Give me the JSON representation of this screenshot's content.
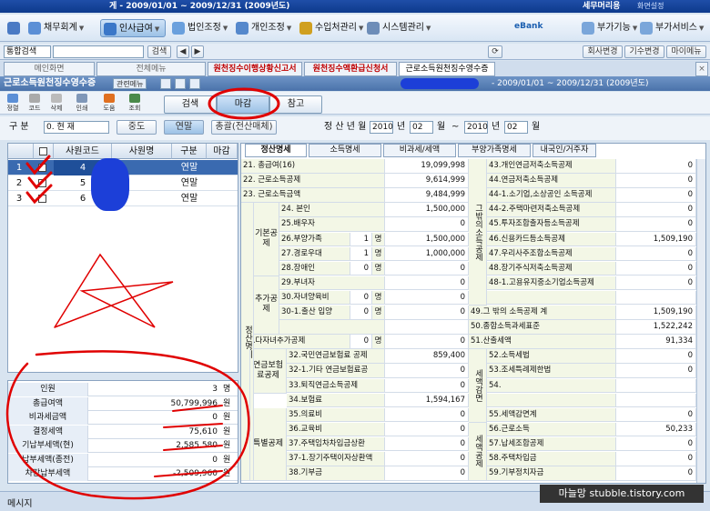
{
  "window": {
    "title": "게 - 2009/01/01 ~ 2009/12/31 (2009년도)",
    "brand": "세무머리용",
    "tray": "화면설정"
  },
  "menu": [
    {
      "label": "채무회계"
    },
    {
      "label": "인사급여"
    },
    {
      "label": "법인조정"
    },
    {
      "label": "개인조정"
    },
    {
      "label": "수입처관리"
    },
    {
      "label": "시스템관리"
    }
  ],
  "menu_right": {
    "bank": "eBank",
    "extra": "부가기능",
    "service": "부가서비스"
  },
  "search": {
    "select": "통합검색",
    "button": "검색"
  },
  "top_buttons": [
    "회사변경",
    "기수변경",
    "마이메뉴"
  ],
  "tabs": [
    "메인화면",
    "전체메뉴",
    "원천징수이행상황신고서",
    "원천징수액환급신청서",
    "근로소득원천징수영수증"
  ],
  "form": {
    "title": "근로소득원천징수영수증",
    "menu_btn": "관련메뉴",
    "period": "- 2009/01/01 ~ 2009/12/31 (2009년도)"
  },
  "iconbar": [
    "정렬",
    "코드",
    "삭제",
    "인쇄",
    "도움",
    "조회"
  ],
  "actions": {
    "search": "검색",
    "close": "마감",
    "ref": "참고"
  },
  "filter": {
    "gubun": "구  분",
    "gubun_val": "0. 현   재",
    "mid": "중도",
    "year": "연말",
    "total": "총괄(전산매체)",
    "period_label": "정 산 년 월",
    "from_year": "2010",
    "from_month": "02",
    "year_unit": "년",
    "month_unit": "월",
    "tilde": "~",
    "to_year": "2010",
    "to_month": "02"
  },
  "emp_grid": {
    "headers": [
      "사원코드",
      "사원명",
      "구분",
      "마감"
    ],
    "rows": [
      {
        "no": "1",
        "code": "4",
        "type": "연말"
      },
      {
        "no": "2",
        "code": "5",
        "type": "연말"
      },
      {
        "no": "3",
        "code": "6",
        "type": "연말"
      }
    ]
  },
  "summary": [
    {
      "label": "인원",
      "value": "3",
      "unit": "명"
    },
    {
      "label": "총급여액",
      "value": "50,799,996",
      "unit": "원"
    },
    {
      "label": "비과세금액",
      "value": "0",
      "unit": "원"
    },
    {
      "label": "결정세액",
      "value": "75,610",
      "unit": "원"
    },
    {
      "label": "기납부세액(현)",
      "value": "2,585,580",
      "unit": "원"
    },
    {
      "label": "납부세액(종전)",
      "value": "0",
      "unit": "원"
    },
    {
      "label": "차감납부세액",
      "value": "-2,509,960",
      "unit": "원"
    }
  ],
  "rtabs": [
    "정산명세",
    "소득명세",
    "비과세/세액",
    "부양가족명세",
    "내국인/거주자"
  ],
  "lrows": [
    {
      "label": "21. 총급여(16)",
      "val": "19,099,998"
    },
    {
      "label": "22. 근로소득공제",
      "val": "9,614,999"
    },
    {
      "label": "23. 근로소득금액",
      "val": "9,484,999"
    },
    {
      "label": "24. 본인",
      "val": "1,500,000"
    },
    {
      "label": "25.배우자",
      "val": "0"
    },
    {
      "label": "26.부양가족",
      "cnt": "1",
      "cu": "명",
      "val": "1,500,000"
    },
    {
      "label": "27.경로우대",
      "cnt": "1",
      "cu": "명",
      "val": "1,000,000"
    },
    {
      "label": "28.장애인",
      "cnt": "0",
      "cu": "명",
      "val": "0"
    },
    {
      "label": "29.부녀자",
      "val": "0"
    },
    {
      "label": "30.자녀양육비",
      "cnt": "0",
      "cu": "명",
      "val": "0"
    },
    {
      "label": "30-1.출산 입양",
      "cnt": "0",
      "cu": "명",
      "val": "0"
    },
    {
      "label": "",
      "val": ""
    },
    {
      "label": "31.다자녀추가공제",
      "cnt": "0",
      "cu": "명",
      "val": "0"
    },
    {
      "label": "32.국민연금보험료 공제",
      "val": "859,400"
    },
    {
      "label": "32-1.기타 연금보험료공",
      "val": "0"
    },
    {
      "label": "33.퇴직연금소득공제",
      "val": "0"
    },
    {
      "label": "34.보험료",
      "val": "1,594,167"
    },
    {
      "label": "35.의료비",
      "val": "0"
    },
    {
      "label": "36.교육비",
      "val": "0"
    },
    {
      "label": "37.주택임차차입금상환",
      "val": "0"
    },
    {
      "label": "37-1.장기주택이자상환액",
      "val": "0"
    },
    {
      "label": "38.기부금",
      "val": "0"
    }
  ],
  "lgroups": [
    "기본공제",
    "추가공제",
    "연금보험료공제",
    "특별공제",
    "정산명세"
  ],
  "rrows": [
    {
      "label": "43.개인연금저축소득공제",
      "val": "0"
    },
    {
      "label": "44.연금저축소득공제",
      "val": "0"
    },
    {
      "label": "44-1.소기업,소상공인 소득공제",
      "val": "0"
    },
    {
      "label": "44-2.주택마련저축소득공제",
      "val": "0"
    },
    {
      "label": "45.투자조합출자등소득공제",
      "val": "0"
    },
    {
      "label": "46.신용카드등소득공제",
      "val": "1,509,190"
    },
    {
      "label": "47.우리사주조합소득공제",
      "val": "0"
    },
    {
      "label": "48.장기주식저축소득공제",
      "val": "0"
    },
    {
      "label": "48-1.고용유지중소기업소득공제",
      "val": "0"
    },
    {
      "label": "",
      "val": ""
    },
    {
      "label": "49.그 밖의 소득공제 계",
      "val": "1,509,190"
    },
    {
      "label": "50.종합소득과세표준",
      "val": "1,522,242"
    },
    {
      "label": "51.산출세액",
      "val": "91,334"
    },
    {
      "label": "52.소득세법",
      "val": "0"
    },
    {
      "label": "53.조세특례제한법",
      "val": "0"
    },
    {
      "label": "54.",
      "val": ""
    },
    {
      "label": "",
      "val": ""
    },
    {
      "label": "55.세액감면계",
      "val": "0"
    },
    {
      "label": "56.근로소득",
      "val": "50,233"
    },
    {
      "label": "57.납세조합공제",
      "val": "0"
    },
    {
      "label": "58.주택차입금",
      "val": "0"
    },
    {
      "label": "59.기부정치자금",
      "val": "0"
    }
  ],
  "rgroups": [
    "그밖의소득공제",
    "세액감면",
    "세액공제"
  ],
  "status": {
    "msg": "메시지"
  },
  "watermark": "마늘망 stubble.tistory.com",
  "colors": {
    "accent": "#3a6ab0",
    "red": "#e00000",
    "redact": "#1c3fd8"
  }
}
